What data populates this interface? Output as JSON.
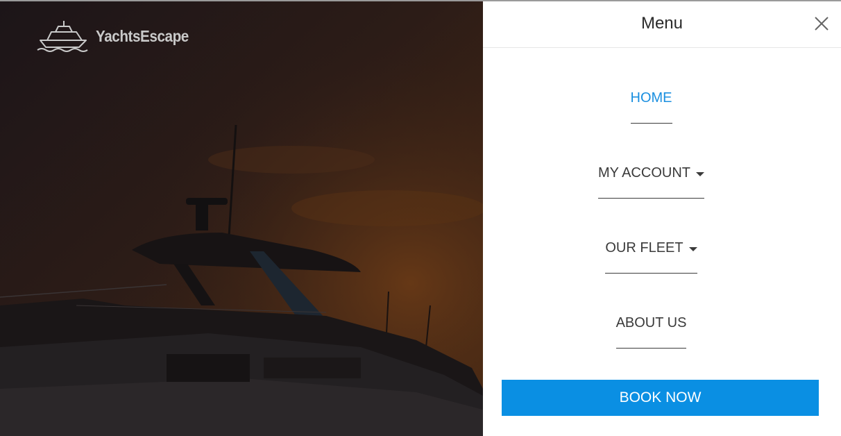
{
  "brand": {
    "name": "YachtsEscape",
    "logo_icon": "yacht-icon"
  },
  "menu": {
    "title": "Menu",
    "close_icon": "close-icon",
    "items": [
      {
        "label": "HOME",
        "active": true,
        "has_dropdown": false
      },
      {
        "label": "MY ACCOUNT",
        "active": false,
        "has_dropdown": true
      },
      {
        "label": "OUR FLEET",
        "active": false,
        "has_dropdown": true
      },
      {
        "label": "ABOUT US",
        "active": false,
        "has_dropdown": false
      }
    ],
    "cta_label": "BOOK NOW"
  },
  "colors": {
    "accent": "#0a8fe3",
    "active_link": "#1a8fe0",
    "text": "#3a3a3a",
    "panel_bg": "#ffffff"
  }
}
